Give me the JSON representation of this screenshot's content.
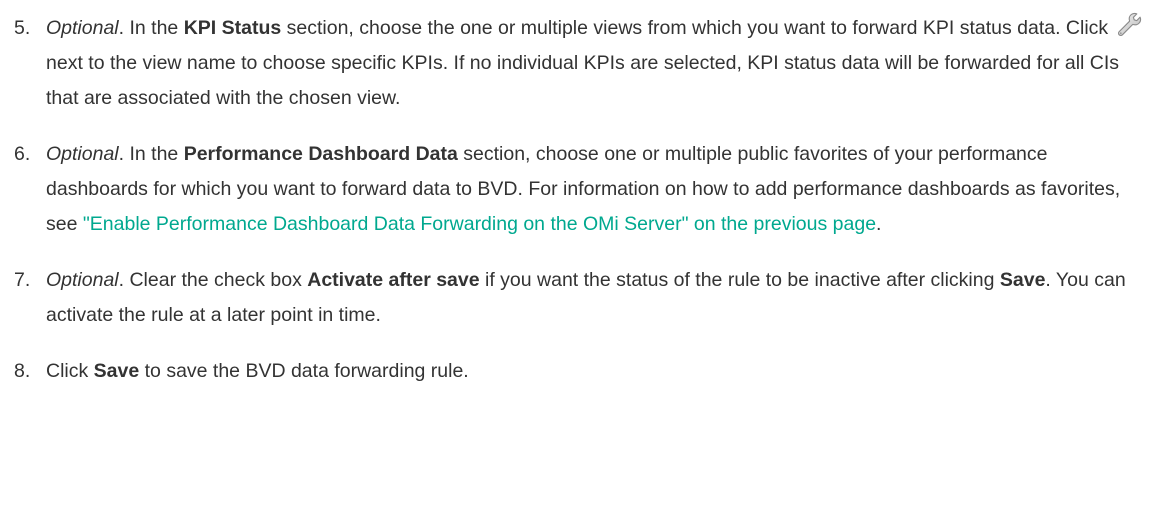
{
  "steps": [
    {
      "number": "5.",
      "optional": "Optional",
      "t1": ". In the ",
      "b1": "KPI Status",
      "t2": " section, choose the one or multiple views from which you want to forward KPI status data. Click ",
      "icon": "wrench-icon",
      "t3": " next to the view name to choose specific KPIs. If no individual KPIs are selected, KPI status data will be forwarded for all CIs that are associated with the chosen view."
    },
    {
      "number": "6.",
      "optional": "Optional",
      "t1": ". In the ",
      "b1": "Performance Dashboard Data",
      "t2": " section, choose one or multiple public favorites of your performance dashboards for which you want to forward data to BVD. For information on how to add performance dashboards as favorites, see ",
      "link": "\"Enable Performance Dashboard Data Forwarding on the OMi Server\" on the previous page",
      "t3": "."
    },
    {
      "number": "7.",
      "optional": "Optional",
      "t1": ". Clear the check box ",
      "b1": "Activate after save",
      "t2": " if you want the status of the rule to be inactive after clicking ",
      "b2": "Save",
      "t3": ". You can activate the rule at a later point in time."
    },
    {
      "number": "8.",
      "t1": "Click ",
      "b1": "Save",
      "t2": " to save the BVD data forwarding rule."
    }
  ],
  "colors": {
    "text": "#333333",
    "link": "#00a88f"
  }
}
